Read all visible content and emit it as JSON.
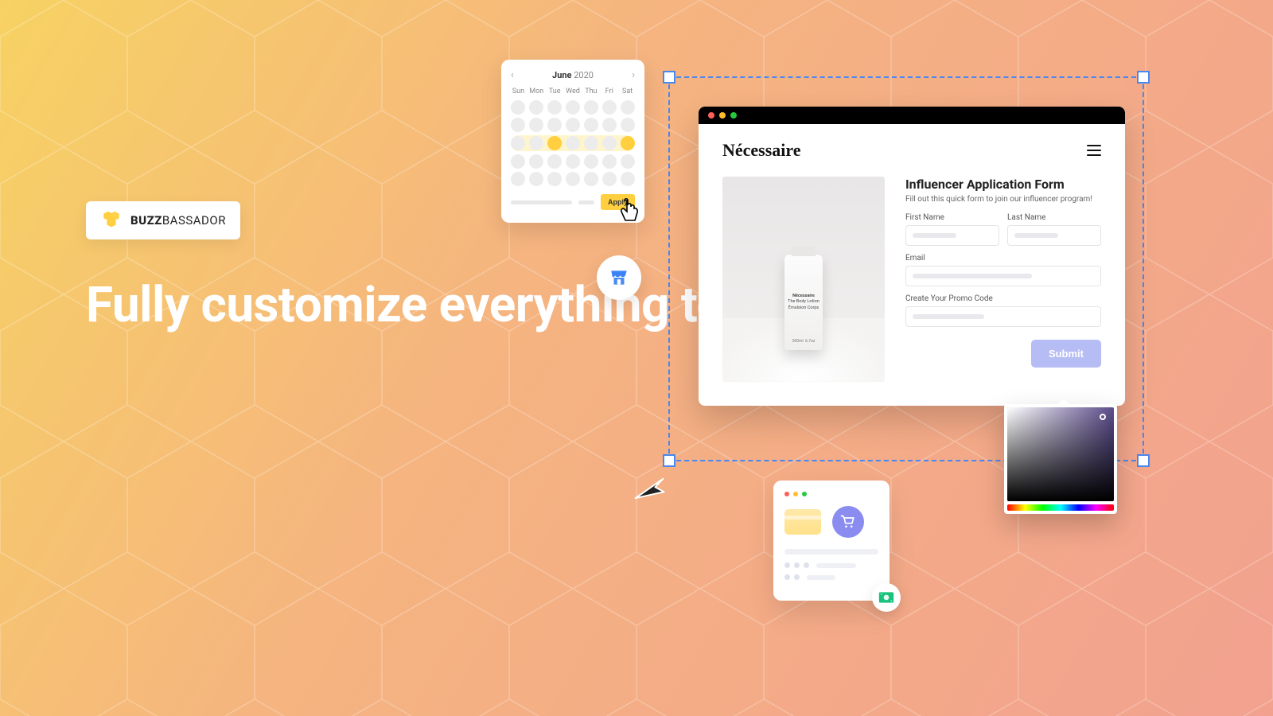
{
  "logo": {
    "bold": "BUZZ",
    "rest": "BASSADOR"
  },
  "headline": "Fully customize everything to meet your needs",
  "calendar": {
    "month": "June",
    "year": "2020",
    "days": [
      "Sun",
      "Mon",
      "Tue",
      "Wed",
      "Thu",
      "Fri",
      "Sat"
    ],
    "apply": "Apply"
  },
  "form": {
    "brand": "Nécessaire",
    "title": "Influencer Application Form",
    "subtitle": "Fill out this quick form to join our influencer program!",
    "first_name": "First Name",
    "last_name": "Last Name",
    "email": "Email",
    "promo": "Create Your Promo Code",
    "submit": "Submit",
    "tube_brand": "Nécessaire",
    "tube_line1": "The Body Lotion",
    "tube_line2": "Émulsion Corps"
  }
}
